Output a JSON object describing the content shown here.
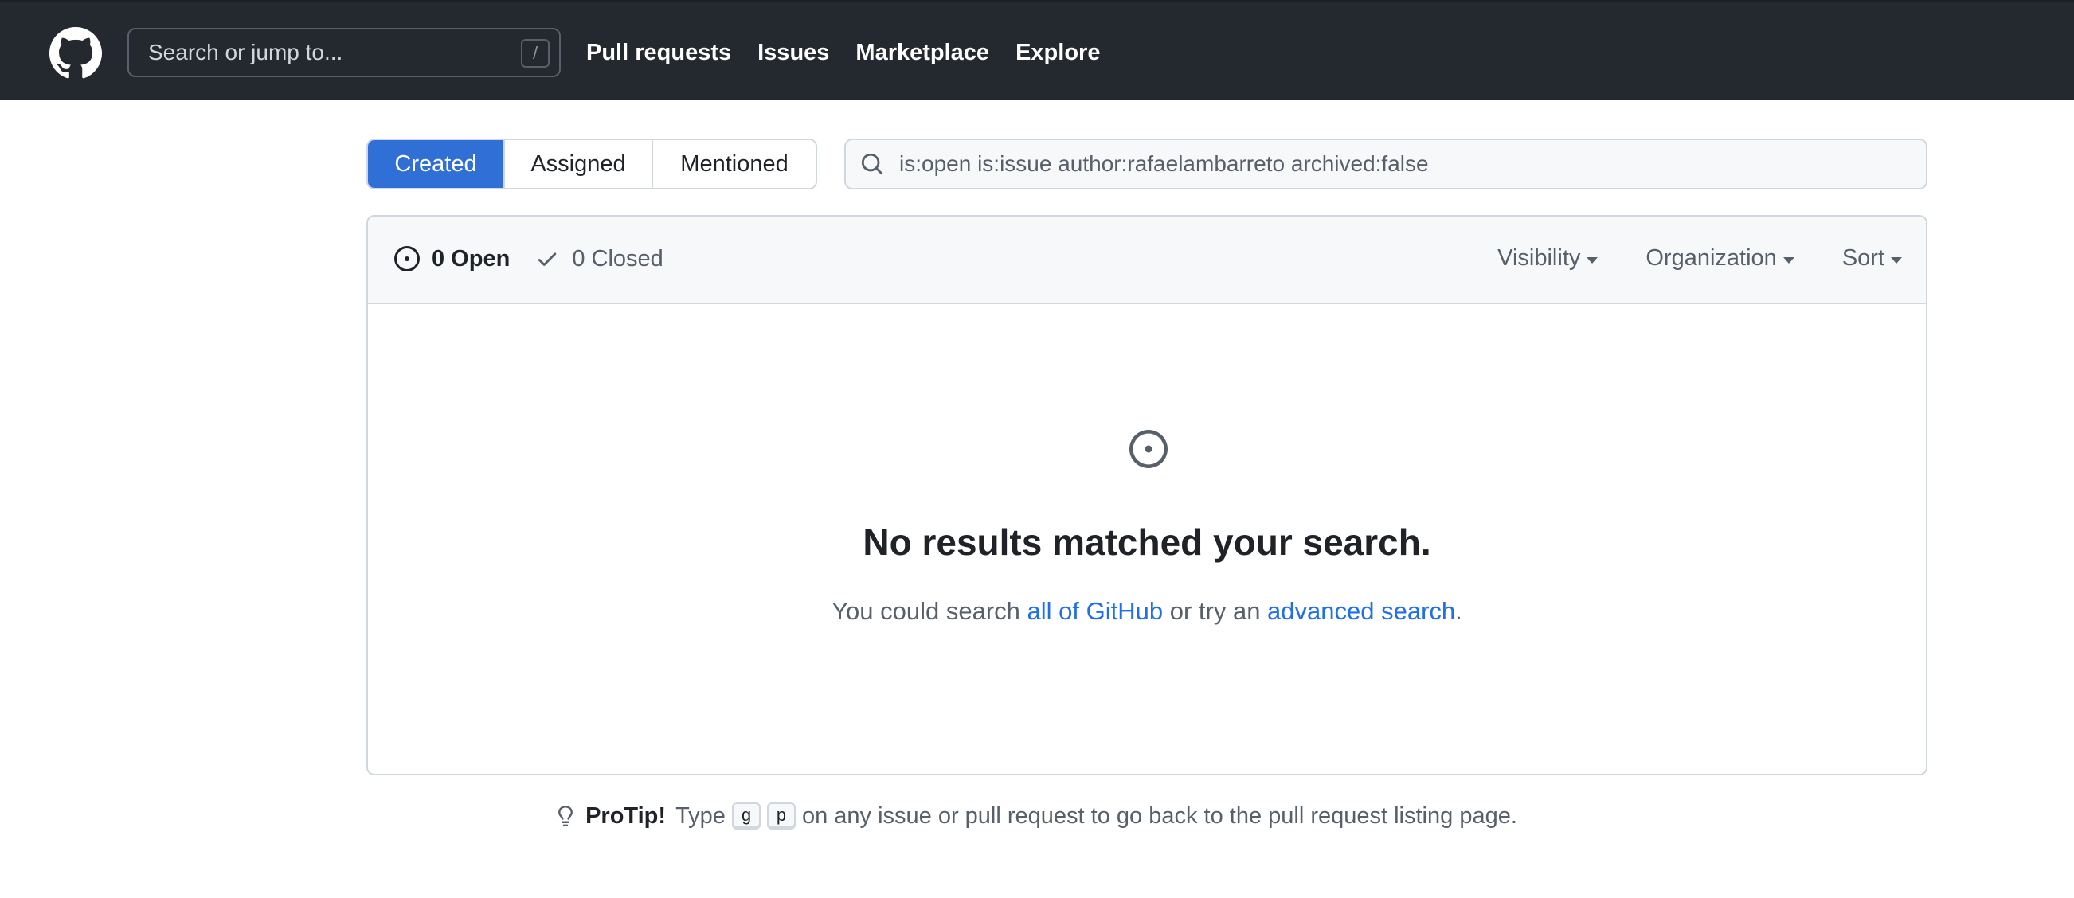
{
  "header": {
    "logo": "github-mark-icon",
    "search_placeholder": "Search or jump to...",
    "search_shortcut": "/",
    "nav": [
      "Pull requests",
      "Issues",
      "Marketplace",
      "Explore"
    ]
  },
  "subnav": {
    "tabs": [
      "Created",
      "Assigned",
      "Mentioned"
    ],
    "active": "Created"
  },
  "filter": {
    "query": "is:open is:issue author:rafaelambarreto archived:false"
  },
  "results": {
    "open_label": "0 Open",
    "closed_label": "0 Closed",
    "filters": [
      "Visibility",
      "Organization",
      "Sort"
    ],
    "blank_title": "No results matched your search.",
    "blank_desc_pre": "You could search ",
    "blank_link_1": "all of GitHub",
    "blank_desc_mid": " or try an ",
    "blank_link_2": "advanced search",
    "blank_desc_post": "."
  },
  "protip": {
    "label": "ProTip!",
    "text_1": "Type",
    "key_1": "g",
    "key_2": "p",
    "text_2": "on any issue or pull request to go back to the pull request listing page."
  },
  "colors": {
    "header_bg": "#24292f",
    "accent": "#2f6fd6",
    "link": "#1f6feb"
  }
}
